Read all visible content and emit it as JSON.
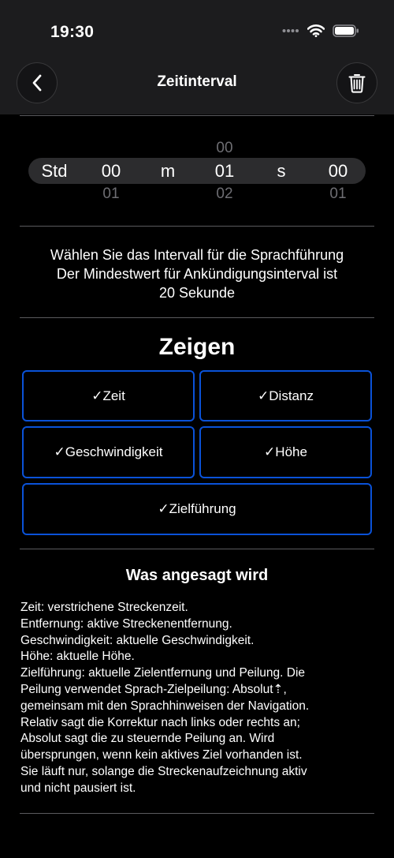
{
  "status_bar": {
    "time": "19:30"
  },
  "nav": {
    "title": "Zeitinterval",
    "back_icon": "chevron-left-icon",
    "trash_icon": "trash-icon"
  },
  "picker": {
    "hours_label": "Std",
    "minutes_label": "m",
    "seconds_label": "s",
    "hours": {
      "above": "",
      "value": "00",
      "below": "01"
    },
    "minutes": {
      "above": "00",
      "value": "01",
      "below": "02"
    },
    "seconds": {
      "above": "",
      "value": "00",
      "below": "01"
    }
  },
  "info": {
    "line1": "Wählen Sie das Intervall für die Sprachführung",
    "line2": "Der Mindestwert für Ankündigungsinterval ist",
    "line3": "20 Sekunde"
  },
  "show_section": {
    "title": "Zeigen",
    "toggles": {
      "zeit": "✓Zeit",
      "distanz": "✓Distanz",
      "geschwindigkeit": "✓Geschwindigkeit",
      "hoehe": "✓Höhe",
      "zielfuehrung": "✓Zielführung"
    },
    "accent_color": "#0a52d8"
  },
  "announced": {
    "title": "Was angesagt wird",
    "lines": [
      "Zeit: verstrichene Streckenzeit.",
      "Entfernung: aktive Streckenentfernung.",
      "Geschwindigkeit: aktuelle Geschwindigkeit.",
      "Höhe: aktuelle Höhe.",
      "Zielführung: aktuelle Zielentfernung und Peilung. Die",
      "Peilung verwendet Sprach-Zielpeilung: Absolut⇡,",
      "gemeinsam mit den Sprachhinweisen der Navigation.",
      "Relativ sagt die Korrektur nach links oder rechts an;",
      "Absolut sagt die zu steuernde Peilung an. Wird",
      "übersprungen, wenn kein aktives Ziel vorhanden ist.",
      "Sie läuft nur, solange die Streckenaufzeichnung aktiv",
      "und nicht pausiert ist."
    ]
  }
}
